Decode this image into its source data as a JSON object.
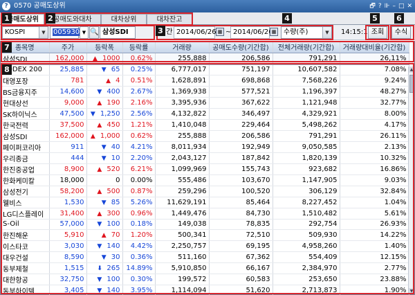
{
  "window": {
    "code": "0570",
    "title": "공매도상위",
    "controls": [
      "🗗",
      "?",
      "⊪",
      "–",
      "□",
      "✕"
    ]
  },
  "tabs": [
    "공매도상위",
    "공매도와대차",
    "대차상위",
    "대차잔고"
  ],
  "toolbar": {
    "market": "KOSPI",
    "stock_code": "005930",
    "stock_name": "삼성SDI",
    "period_label": "기간",
    "date_from": "2014/06/26",
    "date_sep": "~",
    "date_to": "2014/06/26",
    "sort": "수량(주)",
    "time": "14:15:13",
    "query_button": "조회",
    "formula_button": "수식"
  },
  "table": {
    "headers": [
      "종목명",
      "주가",
      "등락폭",
      "등락률",
      "거래량",
      "공매도수량(기간합)",
      "전체거래량(기간합)",
      "거래량대비율(기간합)"
    ],
    "summary": {
      "name": "삼성SDI",
      "price": "162,000",
      "dir": "up",
      "change": "1000",
      "rate": "0.62%",
      "volume": "255,888",
      "short_qty": "206,586",
      "total_volume": "791,291",
      "ratio": "26,11%"
    },
    "rows": [
      {
        "name": "KODEX 200",
        "price": "25,885",
        "dir": "dn",
        "change": "65",
        "rate": "0.25%",
        "volume": "6,777,017",
        "short_qty": "751,197",
        "total_volume": "10,607,582",
        "ratio": "7.08%"
      },
      {
        "name": "대영포장",
        "price": "781",
        "dir": "up",
        "change": "4",
        "rate": "0.51%",
        "volume": "1,628,891",
        "short_qty": "698,868",
        "total_volume": "7,568,226",
        "ratio": "9.24%"
      },
      {
        "name": "BS금융지주",
        "price": "14,600",
        "dir": "dn",
        "change": "400",
        "rate": "2.67%",
        "volume": "1,369,938",
        "short_qty": "577,521",
        "total_volume": "1,196,397",
        "ratio": "48.27%"
      },
      {
        "name": "현대상선",
        "price": "9,000",
        "dir": "up",
        "change": "190",
        "rate": "2.16%",
        "volume": "3,395,936",
        "short_qty": "367,622",
        "total_volume": "1,121,948",
        "ratio": "32.77%"
      },
      {
        "name": "SK하이닉스",
        "price": "47,500",
        "dir": "dn",
        "change": "1,250",
        "rate": "2.56%",
        "volume": "4,132,822",
        "short_qty": "346,497",
        "total_volume": "4,329,921",
        "ratio": "8.00%"
      },
      {
        "name": "한국전력",
        "price": "37,500",
        "dir": "up",
        "change": "450",
        "rate": "1.21%",
        "volume": "1,410,048",
        "short_qty": "229,464",
        "total_volume": "5,498,262",
        "ratio": "4.17%"
      },
      {
        "name": "삼성SDI",
        "price": "162,000",
        "dir": "up",
        "change": "1,000",
        "rate": "0.62%",
        "volume": "255,888",
        "short_qty": "206,586",
        "total_volume": "791,291",
        "ratio": "26.11%"
      },
      {
        "name": "페이퍼코리아",
        "price": "911",
        "dir": "dn",
        "change": "40",
        "rate": "4.21%",
        "volume": "8,011,934",
        "short_qty": "192,949",
        "total_volume": "9,050,585",
        "ratio": "2.13%"
      },
      {
        "name": "우리종금",
        "price": "444",
        "dir": "dn",
        "change": "10",
        "rate": "2.20%",
        "volume": "2,043,127",
        "short_qty": "187,842",
        "total_volume": "1,820,139",
        "ratio": "10.32%"
      },
      {
        "name": "한진중공업",
        "price": "8,900",
        "dir": "up",
        "change": "520",
        "rate": "6.21%",
        "volume": "1,099,969",
        "short_qty": "155,743",
        "total_volume": "923,682",
        "ratio": "16.86%"
      },
      {
        "name": "한화케미칼",
        "price": "18,000",
        "dir": "none",
        "change": "0",
        "rate": "0.00%",
        "volume": "555,486",
        "short_qty": "103,670",
        "total_volume": "1,147,905",
        "ratio": "9.03%"
      },
      {
        "name": "삼성전기",
        "price": "58,200",
        "dir": "up",
        "change": "500",
        "rate": "0.87%",
        "volume": "259,296",
        "short_qty": "100,520",
        "total_volume": "306,129",
        "ratio": "32.84%"
      },
      {
        "name": "웰비스",
        "price": "1,530",
        "dir": "dn",
        "change": "85",
        "rate": "5.26%",
        "volume": "11,629,191",
        "short_qty": "85,464",
        "total_volume": "8,227,452",
        "ratio": "1.04%"
      },
      {
        "name": "LG디스플레이",
        "price": "31,400",
        "dir": "up",
        "change": "300",
        "rate": "0.96%",
        "volume": "1,449,476",
        "short_qty": "84,730",
        "total_volume": "1,510,482",
        "ratio": "5.61%"
      },
      {
        "name": "S-Oil",
        "price": "57,000",
        "dir": "dn",
        "change": "100",
        "rate": "0.18%",
        "volume": "149,038",
        "short_qty": "78,835",
        "total_volume": "292,754",
        "ratio": "26.93%"
      },
      {
        "name": "한진해운",
        "price": "5,910",
        "dir": "up",
        "change": "70",
        "rate": "1.20%",
        "volume": "500,341",
        "short_qty": "72,510",
        "total_volume": "509,930",
        "ratio": "14.22%"
      },
      {
        "name": "이스타코",
        "price": "3,030",
        "dir": "dn",
        "change": "140",
        "rate": "4.42%",
        "volume": "2,250,757",
        "short_qty": "69,195",
        "total_volume": "4,958,260",
        "ratio": "1.40%"
      },
      {
        "name": "대우건설",
        "price": "8,590",
        "dir": "dn",
        "change": "30",
        "rate": "0.36%",
        "volume": "511,160",
        "short_qty": "67,362",
        "total_volume": "554,409",
        "ratio": "12.15%"
      },
      {
        "name": "동부제철",
        "price": "1,515",
        "dir": "dnstrong",
        "change": "265",
        "rate": "14.89%",
        "volume": "5,910,850",
        "short_qty": "66,167",
        "total_volume": "2,384,970",
        "ratio": "2.77%"
      },
      {
        "name": "대한항공",
        "price": "32,750",
        "dir": "dn",
        "change": "100",
        "rate": "0.30%",
        "volume": "199,572",
        "short_qty": "60,583",
        "total_volume": "253,650",
        "ratio": "23.88%"
      },
      {
        "name": "동부하이텍",
        "price": "3,405",
        "dir": "dn",
        "change": "140",
        "rate": "3.95%",
        "volume": "1,114,094",
        "short_qty": "51,620",
        "total_volume": "2,713,873",
        "ratio": "1.90%"
      }
    ]
  },
  "annotations": [
    "1",
    "2",
    "3",
    "4",
    "5",
    "6",
    "7",
    "8"
  ],
  "colors": {
    "up": "#e0141e",
    "down": "#1646d8",
    "highlight": "#d8242c",
    "header": "#c8d6ea"
  }
}
